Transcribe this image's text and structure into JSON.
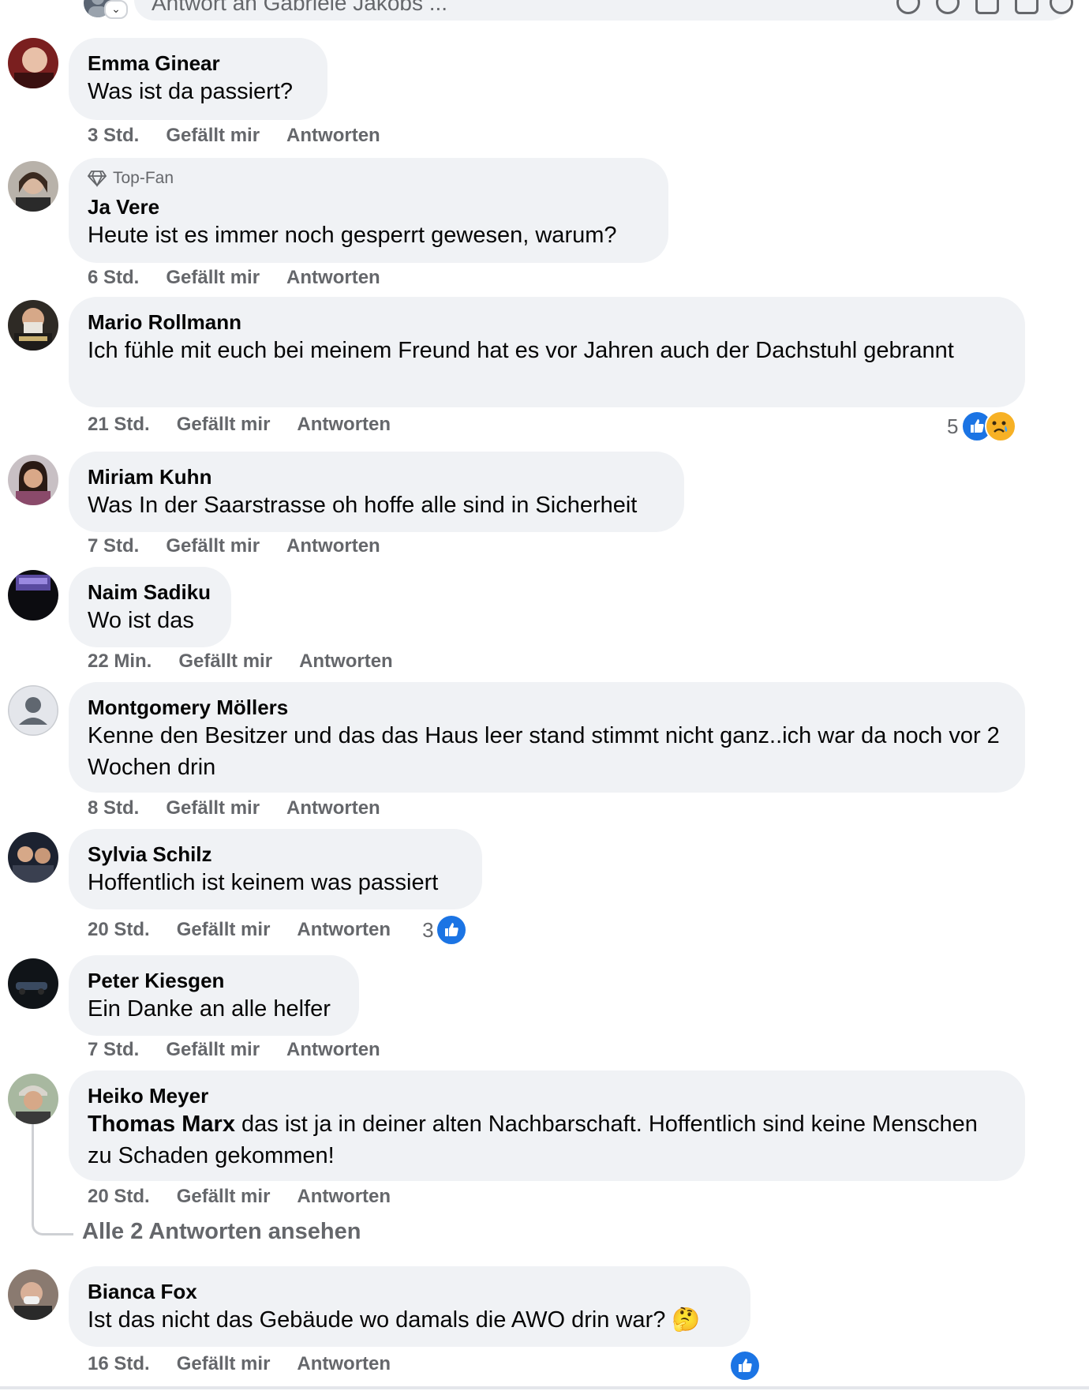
{
  "reply_box": {
    "placeholder": "Antwort an Gabriele Jakobs ..."
  },
  "actions": {
    "like": "Gefällt mir",
    "reply": "Antworten"
  },
  "comments": [
    {
      "name": "Emma Ginear",
      "text": "Was ist da passiert?",
      "time": "3 Std."
    },
    {
      "badge": "Top-Fan",
      "name": "Ja Vere",
      "text": "Heute ist es immer noch gesperrt gewesen, warum?",
      "time": "6 Std."
    },
    {
      "name": "Mario Rollmann",
      "text": "Ich fühle mit euch bei meinem Freund hat es vor Jahren auch der Dachstuhl gebrannt",
      "time": "21 Std.",
      "reaction_count": "5",
      "reactions": [
        "like",
        "sad"
      ]
    },
    {
      "name": "Miriam Kuhn",
      "text": "Was In der Saarstrasse oh hoffe alle sind in Sicherheit",
      "time": "7 Std."
    },
    {
      "name": "Naim Sadiku",
      "text": "Wo ist das",
      "time": "22 Min."
    },
    {
      "name": "Montgomery Möllers",
      "text": "Kenne den Besitzer und das das Haus leer stand stimmt nicht ganz..ich war da noch vor 2 Wochen drin",
      "time": "8 Std."
    },
    {
      "name": "Sylvia Schilz",
      "text": "Hoffentlich ist keinem was passiert",
      "time": "20 Std.",
      "reaction_count": "3",
      "reactions": [
        "like"
      ]
    },
    {
      "name": "Peter Kiesgen",
      "text": "Ein Danke an alle helfer",
      "time": "7 Std."
    },
    {
      "name": "Heiko Meyer",
      "mention": "Thomas Marx",
      "text": " das ist ja in deiner alten Nachbarschaft. Hoffentlich sind keine Menschen zu Schaden gekommen!",
      "time": "20 Std."
    },
    {
      "name": "Bianca Fox",
      "text": "Ist das nicht das Gebäude wo damals die AWO drin war?",
      "emoji": "🤔",
      "time": "16 Std.",
      "reactions": [
        "like"
      ]
    }
  ],
  "view_replies": "Alle 2 Antworten ansehen",
  "colors": {
    "bubble": "#f0f2f5",
    "meta": "#65676b",
    "like_blue": "#1b74e4",
    "sad_yellow": "#f7b125"
  }
}
